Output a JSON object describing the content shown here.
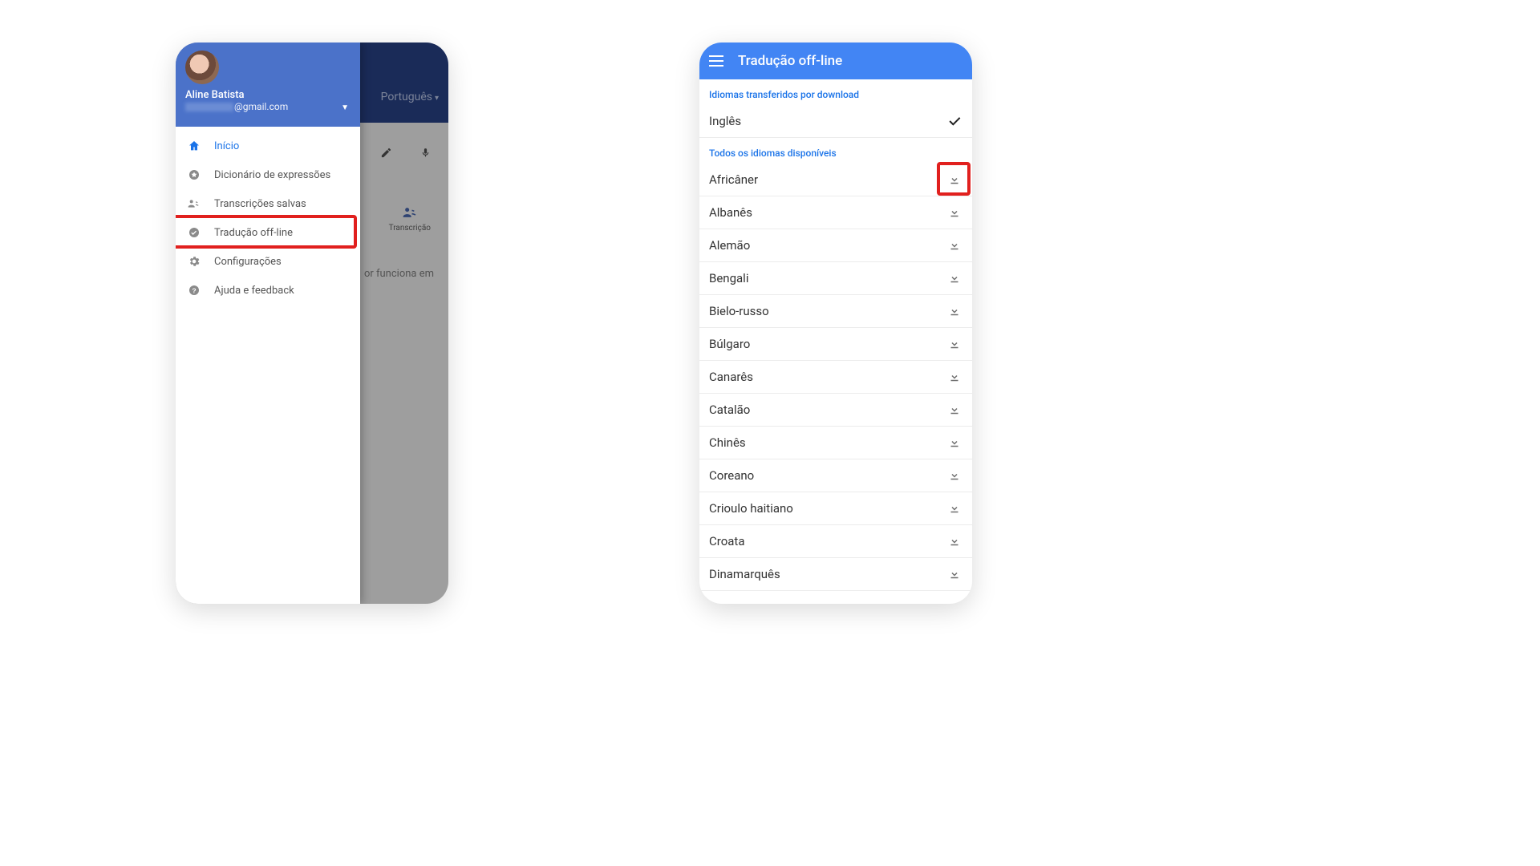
{
  "left": {
    "bg": {
      "language": "Português",
      "transcription": "Transcrição",
      "body_text": "or funciona em"
    },
    "header": {
      "name": "Aline Batista",
      "email_suffix": "@gmail.com"
    },
    "items": [
      {
        "label": "Início",
        "icon": "home",
        "active": true
      },
      {
        "label": "Dicionário de expressões",
        "icon": "star",
        "active": false
      },
      {
        "label": "Transcrições salvas",
        "icon": "voice",
        "active": false
      },
      {
        "label": "Tradução off-line",
        "icon": "offline",
        "active": false,
        "highlight": true
      },
      {
        "label": "Configurações",
        "icon": "gear",
        "active": false
      },
      {
        "label": "Ajuda e feedback",
        "icon": "help",
        "active": false
      }
    ]
  },
  "right": {
    "title": "Tradução off-line",
    "section_downloaded": "Idiomas transferidos por download",
    "section_available": "Todos os idiomas disponíveis",
    "downloaded": [
      {
        "label": "Inglês"
      }
    ],
    "available": [
      {
        "label": "Africâner",
        "highlight": true
      },
      {
        "label": "Albanês"
      },
      {
        "label": "Alemão"
      },
      {
        "label": "Bengali"
      },
      {
        "label": "Bielo-russo"
      },
      {
        "label": "Búlgaro"
      },
      {
        "label": "Canarês"
      },
      {
        "label": "Catalão"
      },
      {
        "label": "Chinês"
      },
      {
        "label": "Coreano"
      },
      {
        "label": "Crioulo haitiano"
      },
      {
        "label": "Croata"
      },
      {
        "label": "Dinamarquês"
      }
    ]
  },
  "colors": {
    "accent": "#4285f4",
    "highlight_red": "#e1201e"
  }
}
